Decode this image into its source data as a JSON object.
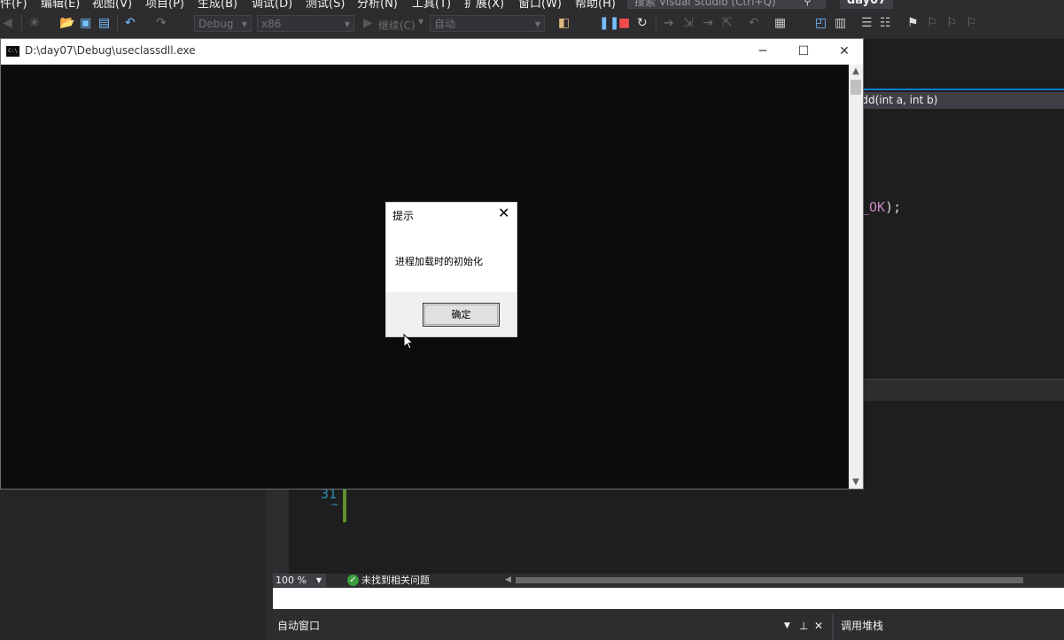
{
  "vs": {
    "menu": [
      "件(F)",
      "编辑(E)",
      "视图(V)",
      "项目(P)",
      "生成(B)",
      "调试(D)",
      "测试(S)",
      "分析(N)",
      "工具(T)",
      "扩展(X)",
      "窗口(W)",
      "帮助(H)"
    ],
    "search_placeholder": "搜索 Visual Studio (Ctrl+Q)",
    "solution_name": "day07",
    "toolbar": {
      "config": "Debug",
      "platform": "x86",
      "continue_label": "继续(C)",
      "thread_dropdown": "自动"
    },
    "nav_member": "add(int a, int b)",
    "code_fragment": "_OK",
    "code_fragment_punct": ");",
    "line_number": "31",
    "status": {
      "zoom": "100 %",
      "issues": "未找到相关问题"
    },
    "autos_title": "自动窗口",
    "callstack_title": "调用堆栈"
  },
  "console": {
    "title": "D:\\day07\\Debug\\useclassdll.exe"
  },
  "messagebox": {
    "title": "提示",
    "text": "进程加载时的初始化",
    "ok_label": "确定"
  },
  "colors": {
    "vs_bg": "#2d2d30",
    "editor_bg": "#1e1e1e",
    "accent": "#007acc",
    "console_bg": "#0c0c0c"
  }
}
